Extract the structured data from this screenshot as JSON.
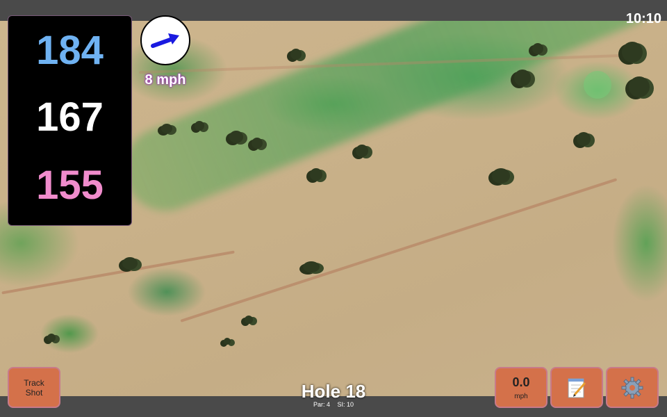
{
  "status_bar": {
    "time": "10:10"
  },
  "distances": {
    "back": "184",
    "middle": "167",
    "front": "155"
  },
  "colors": {
    "back": "#6fb2f2",
    "middle": "#ffffff",
    "front": "#f08ccc",
    "button_bg": "#d4714a"
  },
  "wind": {
    "speed_label": "8 mph",
    "icon": "wind-direction-arrow"
  },
  "buttons": {
    "track_shot_line1": "Track",
    "track_shot_line2": "Shot",
    "speed_value": "0.0",
    "speed_unit": "mph",
    "notes_icon": "notepad-icon",
    "settings_icon": "gear-icon"
  },
  "hole": {
    "title": "Hole 18",
    "par": "Par: 4",
    "si": "SI: 10"
  }
}
